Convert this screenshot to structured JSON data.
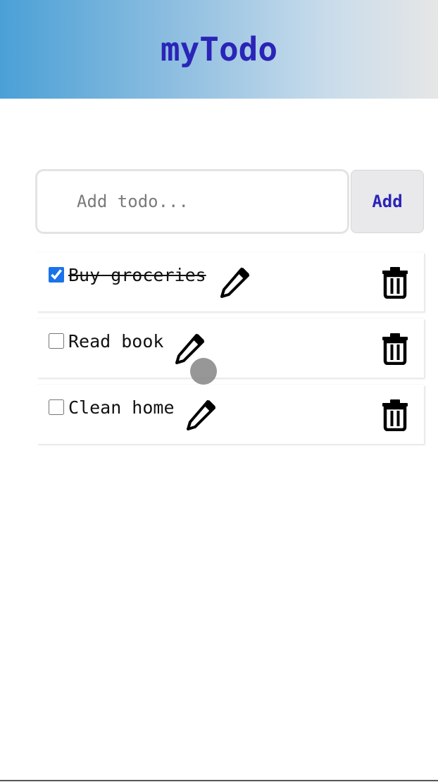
{
  "header": {
    "title": "myTodo"
  },
  "input": {
    "placeholder": "Add todo...",
    "value": ""
  },
  "add_button": {
    "label": "Add"
  },
  "todos": [
    {
      "label": "Buy groceries",
      "checked": true
    },
    {
      "label": "Read book",
      "checked": false
    },
    {
      "label": "Clean home",
      "checked": false
    }
  ],
  "icons": {
    "edit": "pencil-icon",
    "delete": "trash-icon"
  },
  "colors": {
    "title": "#2a24b8",
    "checkbox": "#1a73e8"
  }
}
